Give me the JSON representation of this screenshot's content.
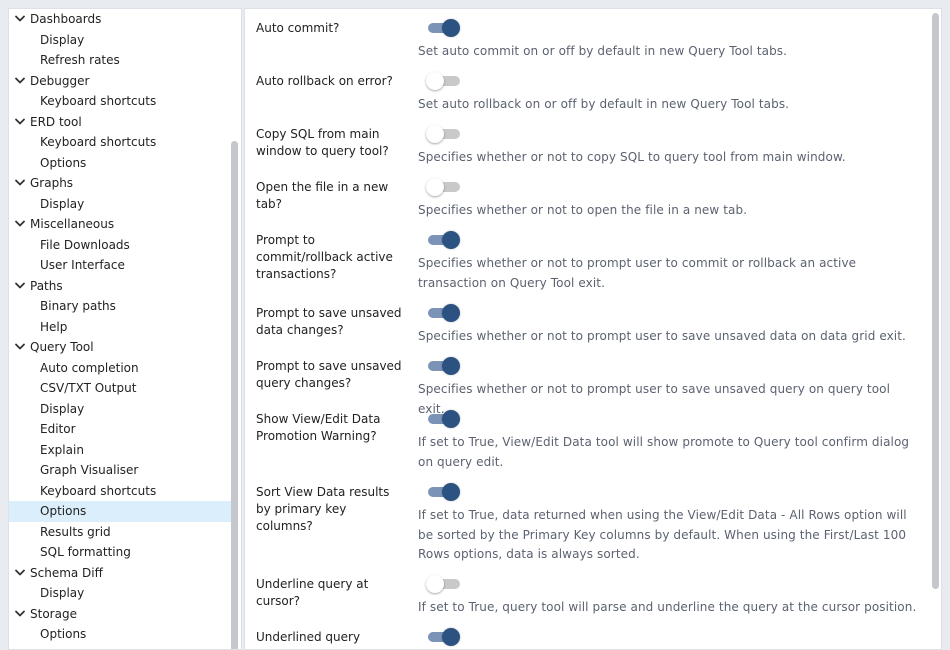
{
  "tree": {
    "items": [
      {
        "type": "group",
        "label": "Dashboards"
      },
      {
        "type": "child",
        "label": "Display"
      },
      {
        "type": "child",
        "label": "Refresh rates"
      },
      {
        "type": "group",
        "label": "Debugger"
      },
      {
        "type": "child",
        "label": "Keyboard shortcuts"
      },
      {
        "type": "group",
        "label": "ERD tool"
      },
      {
        "type": "child",
        "label": "Keyboard shortcuts"
      },
      {
        "type": "child",
        "label": "Options"
      },
      {
        "type": "group",
        "label": "Graphs"
      },
      {
        "type": "child",
        "label": "Display"
      },
      {
        "type": "group",
        "label": "Miscellaneous"
      },
      {
        "type": "child",
        "label": "File Downloads"
      },
      {
        "type": "child",
        "label": "User Interface"
      },
      {
        "type": "group",
        "label": "Paths"
      },
      {
        "type": "child",
        "label": "Binary paths"
      },
      {
        "type": "child",
        "label": "Help"
      },
      {
        "type": "group",
        "label": "Query Tool"
      },
      {
        "type": "child",
        "label": "Auto completion"
      },
      {
        "type": "child",
        "label": "CSV/TXT Output"
      },
      {
        "type": "child",
        "label": "Display"
      },
      {
        "type": "child",
        "label": "Editor"
      },
      {
        "type": "child",
        "label": "Explain"
      },
      {
        "type": "child",
        "label": "Graph Visualiser"
      },
      {
        "type": "child",
        "label": "Keyboard shortcuts"
      },
      {
        "type": "child",
        "label": "Options",
        "selected": true
      },
      {
        "type": "child",
        "label": "Results grid"
      },
      {
        "type": "child",
        "label": "SQL formatting"
      },
      {
        "type": "group",
        "label": "Schema Diff"
      },
      {
        "type": "child",
        "label": "Display"
      },
      {
        "type": "group",
        "label": "Storage"
      },
      {
        "type": "child",
        "label": "Options"
      }
    ]
  },
  "settings": [
    {
      "label": "Auto commit?",
      "on": true,
      "description": "Set auto commit on or off by default in new Query Tool tabs."
    },
    {
      "label": "Auto rollback on error?",
      "on": false,
      "description": "Set auto rollback on or off by default in new Query Tool tabs."
    },
    {
      "label": "Copy SQL from main window to query tool?",
      "on": false,
      "description": "Specifies whether or not to copy SQL to query tool from main window."
    },
    {
      "label": "Open the file in a new tab?",
      "on": false,
      "description": "Specifies whether or not to open the file in a new tab."
    },
    {
      "label": "Prompt to commit/rollback active transactions?",
      "on": true,
      "description": "Specifies whether or not to prompt user to commit or rollback an active transaction on Query Tool exit."
    },
    {
      "label": "Prompt to save unsaved data changes?",
      "on": true,
      "description": "Specifies whether or not to prompt user to save unsaved data on data grid exit."
    },
    {
      "label": "Prompt to save unsaved query changes?",
      "on": true,
      "description": "Specifies whether or not to prompt user to save unsaved query on query tool exit."
    },
    {
      "label": "Show View/Edit Data Promotion Warning?",
      "on": true,
      "description": "If set to True, View/Edit Data tool will show promote to Query tool confirm dialog on query edit."
    },
    {
      "label": "Sort View Data results by primary key columns?",
      "on": true,
      "description": "If set to True, data returned when using the View/Edit Data - All Rows option will be sorted by the Primary Key columns by default. When using the First/Last 100 Rows options, data is always sorted."
    },
    {
      "label": "Underline query at cursor?",
      "on": false,
      "description": "If set to True, query tool will parse and underline the query at the cursor position."
    },
    {
      "label": "Underlined query execute",
      "on": true,
      "description": ""
    }
  ],
  "colors": {
    "accent": "#2c5282",
    "selected_row": "#dbeefb",
    "description_text": "#5b6270"
  }
}
